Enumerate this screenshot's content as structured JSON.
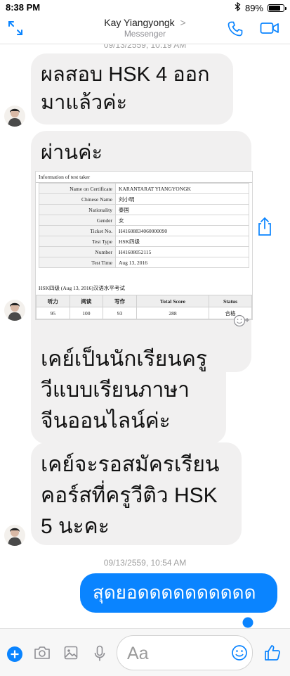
{
  "status_bar": {
    "time": "8:38 PM",
    "battery_percent": "89%",
    "battery_level": 0.89
  },
  "header": {
    "contact_name": "Kay Yiangyongk",
    "chevron": ">",
    "app_name": "Messenger"
  },
  "messages": {
    "timestamp_top": "09/13/2559, 10:19 AM",
    "msg1": "ผลสอบ  HSK 4 ออกมาแล้วค่ะ",
    "msg2": "ผ่านค่ะ",
    "msg3": "เคย์เป็นนักเรียนครูวีแบบเรียนภาษาจีนออนไลน์ค่ะ",
    "msg4": "เคย์จะรอสมัครเรียนคอร์สที่ครูวีติว HSK 5 นะคะ",
    "timestamp2": "09/13/2559, 10:54 AM",
    "sent1": "สุดยอดดดดดดดดดด"
  },
  "certificate": {
    "section_title": "Information of test taker",
    "rows": [
      {
        "label": "Name on Certificate",
        "value": "KARANTARAT YIANGYONGK"
      },
      {
        "label": "Chinese Name",
        "value": "刘小明"
      },
      {
        "label": "Nationality",
        "value": "泰国"
      },
      {
        "label": "Gender",
        "value": "女"
      },
      {
        "label": "Ticket No.",
        "value": "H41608834060000090"
      },
      {
        "label": "Test Type",
        "value": "HSK四级"
      },
      {
        "label": "Number",
        "value": "H41608052115"
      },
      {
        "label": "Test Time",
        "value": "Aug 13, 2016"
      }
    ],
    "score_title": "HSK四级 (Aug 13, 2016)汉语水平考试",
    "score_headers": [
      "听力",
      "阅读",
      "写作",
      "Total Score",
      "Status"
    ],
    "score_values": [
      "95",
      "100",
      "93",
      "288",
      "合格"
    ]
  },
  "input": {
    "placeholder": "Aa"
  },
  "colors": {
    "accent": "#0a84ff",
    "bubble_gray": "#f1f0f0"
  }
}
